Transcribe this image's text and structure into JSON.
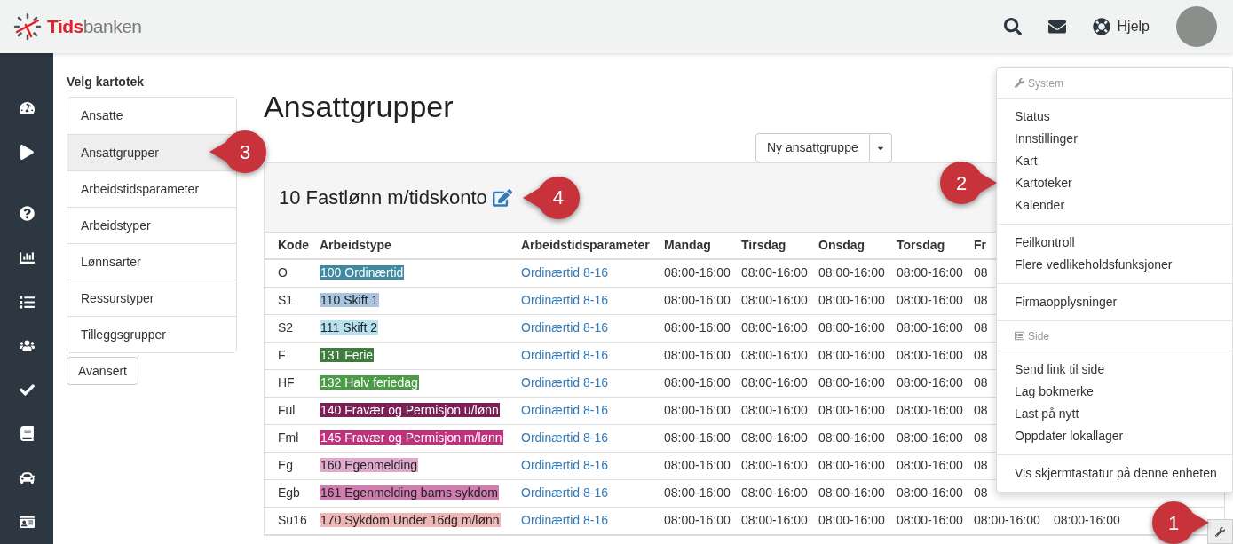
{
  "header": {
    "logo": {
      "brand_red": "Tids",
      "brand_gray": "banken"
    },
    "help_label": "Hjelp"
  },
  "kartotek": {
    "title": "Velg kartotek",
    "items": [
      {
        "label": "Ansatte",
        "selected": false
      },
      {
        "label": "Ansattgrupper",
        "selected": true,
        "callout": "3"
      },
      {
        "label": "Arbeidstidsparameter",
        "selected": false
      },
      {
        "label": "Arbeidstyper",
        "selected": false
      },
      {
        "label": "Lønnsarter",
        "selected": false
      },
      {
        "label": "Ressurstyper",
        "selected": false
      },
      {
        "label": "Tilleggsgrupper",
        "selected": false
      }
    ],
    "advanced_button": "Avansert"
  },
  "page_title": "Ansattgrupper",
  "new_button": "Ny ansattgruppe",
  "panel": {
    "title": "10 Fastlønn m/tidskonto",
    "callout": "4"
  },
  "table": {
    "columns": [
      "Kode",
      "Arbeidstype",
      "Arbeidstidsparameter",
      "Mandag",
      "Tirsdag",
      "Onsdag",
      "Torsdag",
      "Fr"
    ],
    "rows": [
      {
        "code": "O",
        "worktype": "100 Ordinærtid",
        "color": "#3f8a9f",
        "parameter": "Ordinærtid 8-16",
        "days": [
          "08:00-16:00",
          "08:00-16:00",
          "08:00-16:00",
          "08:00-16:00",
          "08"
        ]
      },
      {
        "code": "S1",
        "worktype": "110 Skift 1",
        "color": "#a9c5e2",
        "parameter": "Ordinærtid 8-16",
        "days": [
          "08:00-16:00",
          "08:00-16:00",
          "08:00-16:00",
          "08:00-16:00",
          "08"
        ]
      },
      {
        "code": "S2",
        "worktype": "111 Skift 2",
        "color": "#b6e1ef",
        "parameter": "Ordinærtid 8-16",
        "days": [
          "08:00-16:00",
          "08:00-16:00",
          "08:00-16:00",
          "08:00-16:00",
          "08"
        ]
      },
      {
        "code": "F",
        "worktype": "131 Ferie",
        "color": "#3e7d3c",
        "parameter": "Ordinærtid 8-16",
        "days": [
          "08:00-16:00",
          "08:00-16:00",
          "08:00-16:00",
          "08:00-16:00",
          "08"
        ]
      },
      {
        "code": "HF",
        "worktype": "132 Halv feriedag",
        "color": "#4b9b47",
        "parameter": "Ordinærtid 8-16",
        "days": [
          "08:00-16:00",
          "08:00-16:00",
          "08:00-16:00",
          "08:00-16:00",
          "08"
        ]
      },
      {
        "code": "Ful",
        "worktype": "140 Fravær og Permisjon u/lønn",
        "color": "#7c1f56",
        "parameter": "Ordinærtid 8-16",
        "days": [
          "08:00-16:00",
          "08:00-16:00",
          "08:00-16:00",
          "08:00-16:00",
          "08"
        ]
      },
      {
        "code": "Fml",
        "worktype": "145 Fravær og Permisjon m/lønn",
        "color": "#c0317d",
        "parameter": "Ordinærtid 8-16",
        "days": [
          "08:00-16:00",
          "08:00-16:00",
          "08:00-16:00",
          "08:00-16:00",
          "08"
        ]
      },
      {
        "code": "Eg",
        "worktype": "160 Egenmelding",
        "color": "#e1a9cc",
        "parameter": "Ordinærtid 8-16",
        "days": [
          "08:00-16:00",
          "08:00-16:00",
          "08:00-16:00",
          "08:00-16:00",
          "08"
        ]
      },
      {
        "code": "Egb",
        "worktype": "161 Egenmelding barns sykdom",
        "color": "#d17db1",
        "parameter": "Ordinærtid 8-16",
        "days": [
          "08:00-16:00",
          "08:00-16:00",
          "08:00-16:00",
          "08:00-16:00",
          "08"
        ]
      },
      {
        "code": "Su16",
        "worktype": "170 Sykdom Under 16dg m/lønn",
        "color": "#f0b5b5",
        "parameter": "Ordinærtid 8-16",
        "days": [
          "08:00-16:00",
          "08:00-16:00",
          "08:00-16:00",
          "08:00-16:00",
          "08:00-16:00",
          "08:00-16:00"
        ]
      }
    ]
  },
  "menu": {
    "sections": [
      {
        "header": "System",
        "items": [
          {
            "label": "Status"
          },
          {
            "label": "Innstillinger"
          },
          {
            "label": "Kart"
          },
          {
            "label": "Kartoteker",
            "callout": "2"
          },
          {
            "label": "Kalender"
          }
        ]
      },
      {
        "items": [
          {
            "label": "Feilkontroll"
          },
          {
            "label": "Flere vedlikeholdsfunksjoner"
          }
        ]
      },
      {
        "items": [
          {
            "label": "Firmaopplysninger"
          }
        ]
      },
      {
        "header": "Side",
        "items": [
          {
            "label": "Send link til side"
          },
          {
            "label": "Lag bokmerke"
          },
          {
            "label": "Last på nytt"
          },
          {
            "label": "Oppdater lokallager"
          }
        ]
      },
      {
        "items": [
          {
            "label": "Vis skjermtastatur på denne enheten"
          }
        ]
      }
    ]
  },
  "tools_button": {
    "callout": "1"
  }
}
